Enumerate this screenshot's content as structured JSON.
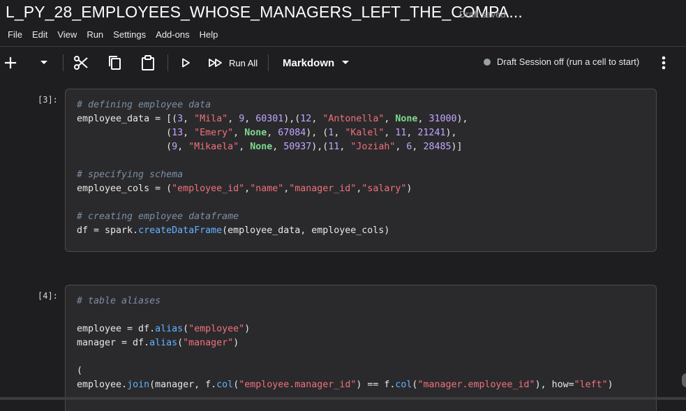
{
  "title": "L_PY_28_EMPLOYEES_WHOSE_MANAGERS_LEFT_THE_COMPA...",
  "draft_status": "Draft saved",
  "menu": [
    "File",
    "Edit",
    "View",
    "Run",
    "Settings",
    "Add-ons",
    "Help"
  ],
  "toolbar": {
    "add_label": "+",
    "run_all_label": "Run All",
    "cell_type": "Markdown",
    "session_status": "Draft Session off (run a cell to start)"
  },
  "cells": [
    {
      "prompt": "[3]:",
      "lines": [
        "# defining employee data",
        "employee_data = [(3, \"Mila\", 9, 60301),(12, \"Antonella\", None, 31000),",
        "                (13, \"Emery\", None, 67084), (1, \"Kalel\", 11, 21241),",
        "                (9, \"Mikaela\", None, 50937),(11, \"Joziah\", 6, 28485)]",
        "",
        "# specifying schema",
        "employee_cols = (\"employee_id\",\"name\",\"manager_id\",\"salary\")",
        "",
        "# creating employee dataframe",
        "df = spark.createDataFrame(employee_data, employee_cols)"
      ]
    },
    {
      "prompt": "[4]:",
      "lines": [
        "# table aliases",
        "",
        "employee = df.alias(\"employee\")",
        "manager = df.alias(\"manager\")",
        "",
        "(",
        "employee.join(manager, f.col(\"employee.manager_id\") == f.col(\"manager.employee_id\"), how=\"left\")"
      ]
    }
  ],
  "colors": {
    "background": "#1e1e20",
    "cell_background": "#2a2a2d",
    "comment": "#7d8fa3",
    "string": "#f07178",
    "number": "#c3a6ff",
    "keyword": "#7fd88f",
    "function": "#66b2ff"
  },
  "icons": [
    "add-icon",
    "chevron-down-icon",
    "cut-icon",
    "copy-icon",
    "paste-icon",
    "run-icon",
    "run-all-icon",
    "more-vert-icon"
  ]
}
